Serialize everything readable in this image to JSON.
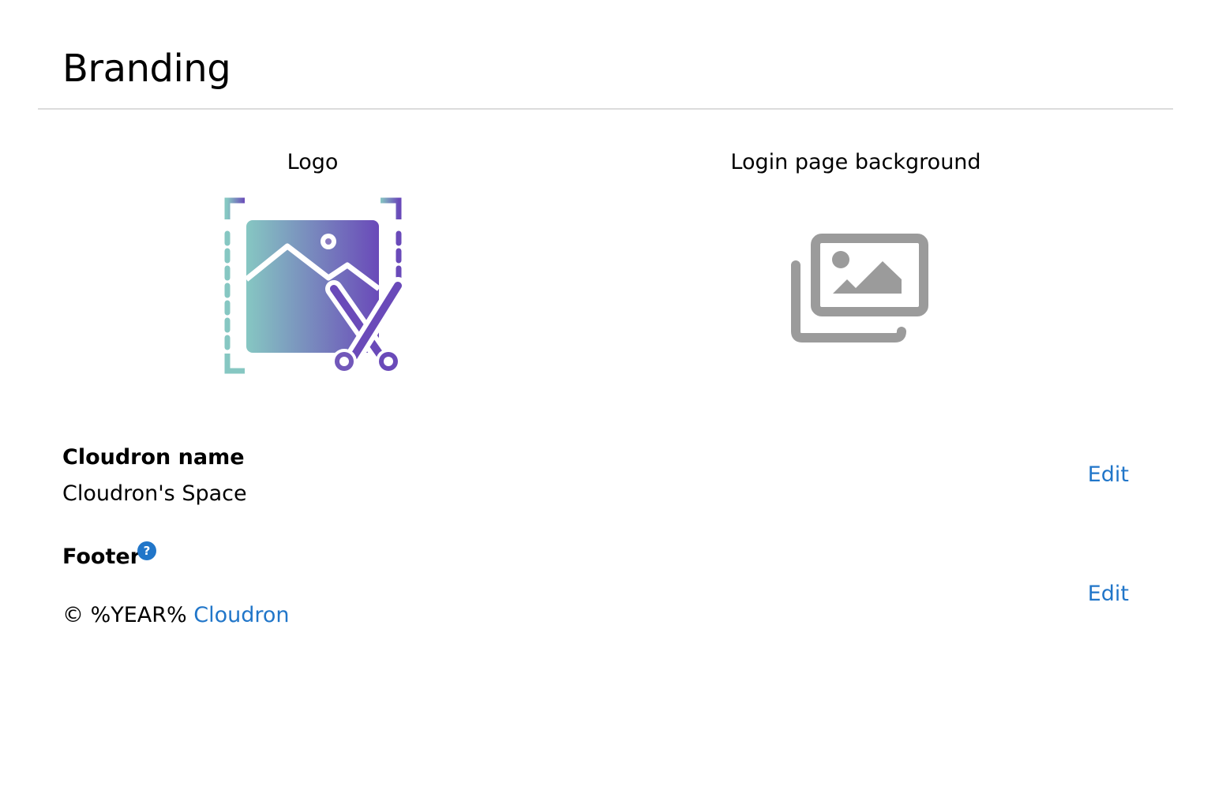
{
  "page": {
    "title": "Branding"
  },
  "logo": {
    "label": "Logo",
    "icon": "image-edit-icon"
  },
  "background": {
    "label": "Login page background",
    "icon": "images-icon"
  },
  "cloudron_name": {
    "label": "Cloudron name",
    "value": "Cloudron's Space",
    "edit_label": "Edit"
  },
  "footer": {
    "label": "Footer",
    "help_icon": "question-circle-icon",
    "help_glyph": "?",
    "value_prefix": "© %YEAR%",
    "value_link": "Cloudron",
    "edit_label": "Edit"
  },
  "colors": {
    "accent": "#2176c9",
    "logo_gradient_start": "#86c7c2",
    "logo_gradient_end": "#6a4ab9",
    "placeholder_gray": "#9b9b9b",
    "divider": "#dcdcdc"
  }
}
